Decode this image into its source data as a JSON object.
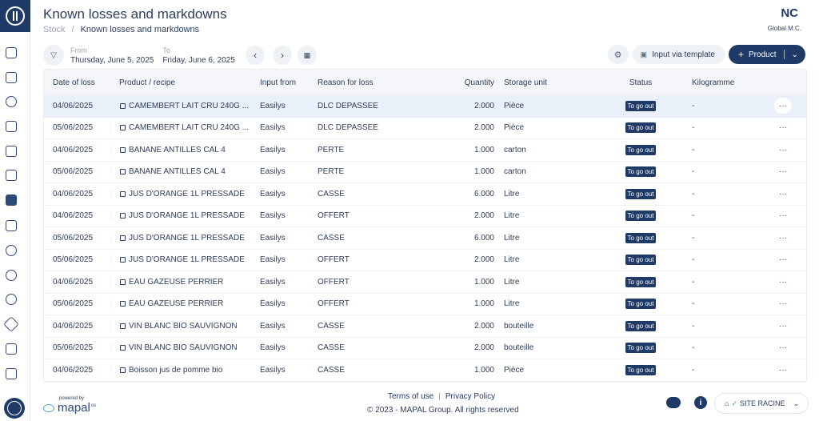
{
  "header": {
    "title": "Known losses and markdowns",
    "breadcrumb": [
      "Stock",
      "Known losses and markdowns"
    ],
    "org_code": "NC",
    "org_name": "Global M.C."
  },
  "filters": {
    "from_label": "From",
    "from_value": "Thursday, June 5, 2025",
    "to_label": "To",
    "to_value": "Friday, June 6, 2025"
  },
  "toolbar": {
    "template_label": "Input via template",
    "product_label": "Product"
  },
  "table": {
    "headers": [
      "Date of loss",
      "Product / recipe",
      "Input from",
      "Reason for loss",
      "Quantity",
      "Storage unit",
      "Status",
      "Kilogramme"
    ],
    "rows": [
      {
        "date": "04/06/2025",
        "product": "CAMEMBERT LAIT CRU 240G ...",
        "input": "Easilys",
        "reason": "DLC DEPASSEE",
        "qty": "2.000",
        "unit": "Pièce",
        "status": "To go out",
        "kg": "-",
        "more": "···"
      },
      {
        "date": "05/06/2025",
        "product": "CAMEMBERT LAIT CRU 240G ...",
        "input": "Easilys",
        "reason": "DLC DEPASSEE",
        "qty": "2.000",
        "unit": "Pièce",
        "status": "To go out",
        "kg": "-",
        "more": "···"
      },
      {
        "date": "04/06/2025",
        "product": "BANANE ANTILLES CAL 4",
        "input": "Easilys",
        "reason": "PERTE",
        "qty": "1.000",
        "unit": "carton",
        "status": "To go out",
        "kg": "-",
        "more": "···"
      },
      {
        "date": "05/06/2025",
        "product": "BANANE ANTILLES CAL 4",
        "input": "Easilys",
        "reason": "PERTE",
        "qty": "1.000",
        "unit": "carton",
        "status": "To go out",
        "kg": "-",
        "more": "···"
      },
      {
        "date": "04/06/2025",
        "product": "JUS D'ORANGE 1L PRESSADE",
        "input": "Easilys",
        "reason": "CASSE",
        "qty": "6.000",
        "unit": "Litre",
        "status": "To go out",
        "kg": "-",
        "more": "···"
      },
      {
        "date": "04/06/2025",
        "product": "JUS D'ORANGE 1L PRESSADE",
        "input": "Easilys",
        "reason": "OFFERT",
        "qty": "2.000",
        "unit": "Litre",
        "status": "To go out",
        "kg": "-",
        "more": "···"
      },
      {
        "date": "05/06/2025",
        "product": "JUS D'ORANGE 1L PRESSADE",
        "input": "Easilys",
        "reason": "CASSE",
        "qty": "6.000",
        "unit": "Litre",
        "status": "To go out",
        "kg": "-",
        "more": "···"
      },
      {
        "date": "05/06/2025",
        "product": "JUS D'ORANGE 1L PRESSADE",
        "input": "Easilys",
        "reason": "OFFERT",
        "qty": "2.000",
        "unit": "Litre",
        "status": "To go out",
        "kg": "-",
        "more": "···"
      },
      {
        "date": "04/06/2025",
        "product": "EAU GAZEUSE PERRIER",
        "input": "Easilys",
        "reason": "OFFERT",
        "qty": "1.000",
        "unit": "Litre",
        "status": "To go out",
        "kg": "-",
        "more": "···"
      },
      {
        "date": "05/06/2025",
        "product": "EAU GAZEUSE PERRIER",
        "input": "Easilys",
        "reason": "OFFERT",
        "qty": "1.000",
        "unit": "Litre",
        "status": "To go out",
        "kg": "-",
        "more": "···"
      },
      {
        "date": "04/06/2025",
        "product": "VIN BLANC BIO SAUVIGNON",
        "input": "Easilys",
        "reason": "CASSE",
        "qty": "2.000",
        "unit": "bouteille",
        "status": "To go out",
        "kg": "-",
        "more": "···"
      },
      {
        "date": "05/06/2025",
        "product": "VIN BLANC BIO SAUVIGNON",
        "input": "Easilys",
        "reason": "CASSE",
        "qty": "2.000",
        "unit": "bouteille",
        "status": "To go out",
        "kg": "-",
        "more": "···"
      },
      {
        "date": "04/06/2025",
        "product": "Boisson jus de pomme bio",
        "input": "Easilys",
        "reason": "CASSE",
        "qty": "1.000",
        "unit": "Pièce",
        "status": "To go out",
        "kg": "-",
        "more": "···"
      }
    ]
  },
  "footer": {
    "powered_by": "powered by",
    "brand": "mapal",
    "brand_suffix": "os",
    "terms": "Terms of use",
    "privacy": "Privacy Policy",
    "copyright": "© 2023 - MAPAL Group. All rights reserved",
    "site": "SITE RACINE"
  },
  "colors": {
    "brand": "#1f3a67",
    "highlight_row": "#eaf0fa",
    "header_bg": "#f4f6f9"
  }
}
